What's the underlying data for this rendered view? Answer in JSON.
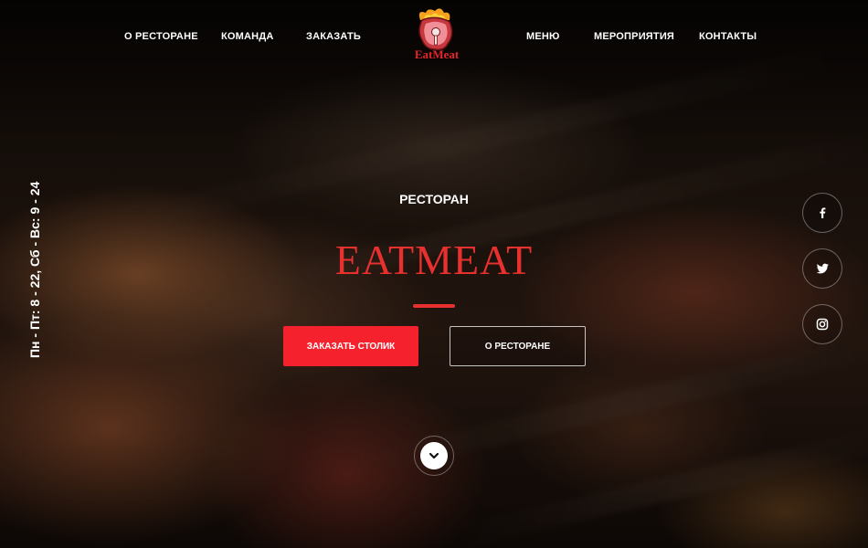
{
  "nav": {
    "left": [
      "О РЕСТОРАНЕ",
      "КОМАНДА",
      "ЗАКАЗАТЬ"
    ],
    "right": [
      "МЕНЮ",
      "МЕРОПРИЯТИЯ",
      "КОНТАКТЫ"
    ]
  },
  "logo": {
    "text": "EatMeat",
    "icon": "meat-logo-icon"
  },
  "schedule": "Пн - Пт: 8 - 22, Сб - Вс: 9 - 24",
  "hero": {
    "kicker": "РЕСТОРАН",
    "title": "EATMEAT",
    "primary_button": "ЗАКАЗАТЬ СТОЛИК",
    "secondary_button": "О РЕСТОРАНЕ",
    "scroll_icon": "chevron-down-icon"
  },
  "social": [
    "facebook-icon",
    "twitter-icon",
    "instagram-icon"
  ],
  "colors": {
    "accent": "#f5222d",
    "title": "#e8312f",
    "text": "#ffffff"
  }
}
